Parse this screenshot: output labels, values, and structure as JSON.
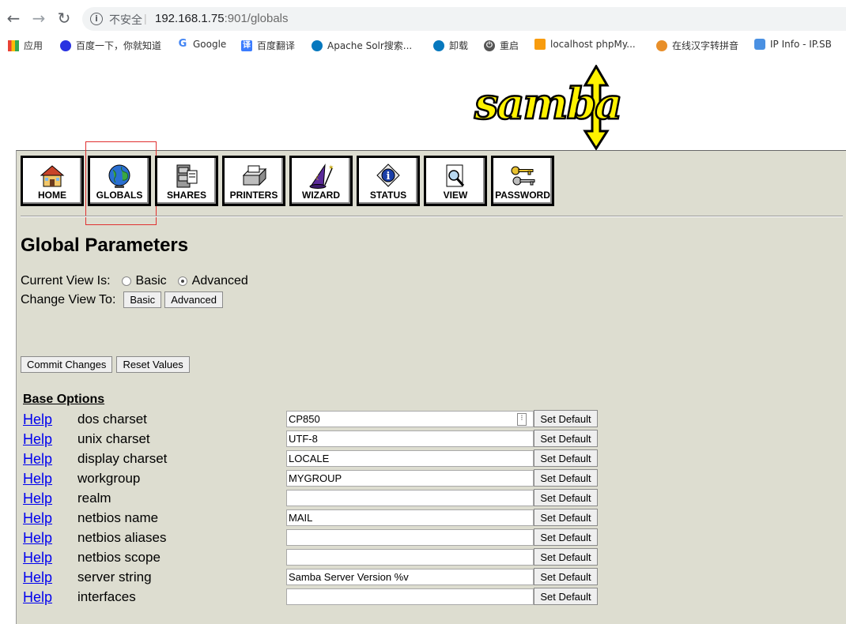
{
  "browser": {
    "back_glyph": "←",
    "forward_glyph": "→",
    "reload_glyph": "↻",
    "security_label": "不安全",
    "url_host": "192.168.1.75",
    "url_rest": ":901/globals"
  },
  "bookmarks": [
    {
      "label": "应用",
      "icon": "apps-grid-icon",
      "color": "#e94235"
    },
    {
      "label": "百度一下，你就知道",
      "icon": "baidu-paw-icon",
      "color": "#2932e1"
    },
    {
      "label": "Google",
      "icon": "google-g-icon",
      "color": "#4285f4"
    },
    {
      "label": "百度翻译",
      "icon": "translate-icon",
      "color": "#3b7cff"
    },
    {
      "label": "Apache Solr搜索...",
      "icon": "drupal-icon",
      "color": "#0678be"
    },
    {
      "label": "卸载",
      "icon": "drupal-icon",
      "color": "#0678be"
    },
    {
      "label": "重启",
      "icon": "power-icon",
      "color": "#555555"
    },
    {
      "label": "localhost phpMy...",
      "icon": "phpmyadmin-icon",
      "color": "#f89c0e"
    },
    {
      "label": "在线汉字转拼音",
      "icon": "swirl-icon",
      "color": "#e88f2a"
    },
    {
      "label": "IP Info - IP.SB",
      "icon": "ip-info-icon",
      "color": "#4a90e2"
    }
  ],
  "nav": [
    {
      "label": "HOME",
      "icon": "house-icon"
    },
    {
      "label": "GLOBALS",
      "icon": "globe-icon"
    },
    {
      "label": "SHARES",
      "icon": "file-cabinet-icon"
    },
    {
      "label": "PRINTERS",
      "icon": "printer-icon"
    },
    {
      "label": "WIZARD",
      "icon": "wizard-hat-icon"
    },
    {
      "label": "STATUS",
      "icon": "info-badge-icon"
    },
    {
      "label": "VIEW",
      "icon": "magnifier-doc-icon"
    },
    {
      "label": "PASSWORD",
      "icon": "keys-icon"
    }
  ],
  "page": {
    "title": "Global Parameters",
    "current_view_label": "Current View Is:",
    "view_basic": "Basic",
    "view_advanced": "Advanced",
    "change_view_label": "Change View To:",
    "basic_button": "Basic",
    "advanced_button": "Advanced",
    "commit_button": "Commit Changes",
    "reset_button": "Reset Values",
    "section_title": "Base Options",
    "help_label": "Help",
    "set_default_label": "Set Default"
  },
  "params": [
    {
      "name": "dos charset",
      "value": "CP850"
    },
    {
      "name": "unix charset",
      "value": "UTF-8"
    },
    {
      "name": "display charset",
      "value": "LOCALE"
    },
    {
      "name": "workgroup",
      "value": "MYGROUP"
    },
    {
      "name": "realm",
      "value": ""
    },
    {
      "name": "netbios name",
      "value": "MAIL"
    },
    {
      "name": "netbios aliases",
      "value": ""
    },
    {
      "name": "netbios scope",
      "value": ""
    },
    {
      "name": "server string",
      "value": "Samba Server Version %v"
    },
    {
      "name": "interfaces",
      "value": ""
    }
  ]
}
